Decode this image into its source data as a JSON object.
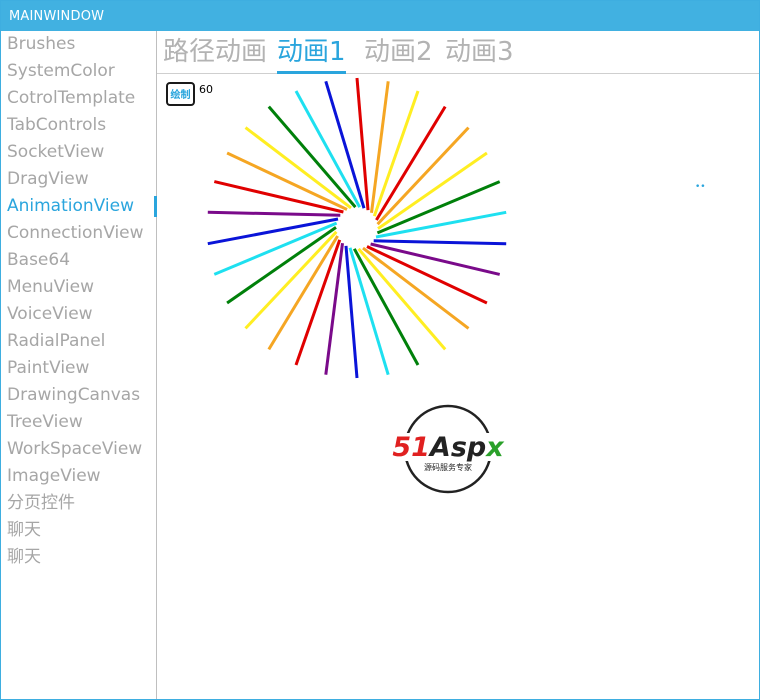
{
  "window": {
    "title": "MAINWINDOW"
  },
  "sidebar": {
    "items": [
      {
        "label": "Brushes"
      },
      {
        "label": "SystemColor"
      },
      {
        "label": "CotrolTemplate"
      },
      {
        "label": "TabControls"
      },
      {
        "label": "SocketView"
      },
      {
        "label": "DragView"
      },
      {
        "label": "AnimationView",
        "active": true
      },
      {
        "label": "ConnectionView"
      },
      {
        "label": "Base64"
      },
      {
        "label": "MenuView"
      },
      {
        "label": "VoiceView"
      },
      {
        "label": "RadialPanel"
      },
      {
        "label": "PaintView"
      },
      {
        "label": "DrawingCanvas"
      },
      {
        "label": "TreeView"
      },
      {
        "label": "WorkSpaceView"
      },
      {
        "label": "ImageView"
      },
      {
        "label": "分页控件"
      },
      {
        "label": "聊天"
      },
      {
        "label": "聊天"
      }
    ]
  },
  "tabs": [
    {
      "label": "路径动画"
    },
    {
      "label": "动画1",
      "active": true
    },
    {
      "label": "动画2"
    },
    {
      "label": "动画3"
    }
  ],
  "content": {
    "draw_button_label": "绘制",
    "count_value": "60",
    "small_mark": "••"
  },
  "animation": {
    "ray_count": 30,
    "colors": [
      "#e00000",
      "#f5a623",
      "#ffee22",
      "#e00000",
      "#f5a623",
      "#ffee22",
      "#00800a",
      "#1ee0f0",
      "#0a14d8",
      "#7a0a8a",
      "#e00000",
      "#f5a623",
      "#ffee22",
      "#00800a",
      "#1ee0f0",
      "#0a14d8",
      "#7a0a8a",
      "#e00000",
      "#f5a623",
      "#ffee22",
      "#00800a",
      "#1ee0f0",
      "#0a14d8",
      "#7a0a8a",
      "#e00000",
      "#f5a623",
      "#ffee22",
      "#00800a",
      "#1ee0f0",
      "#0a14d8",
      "#7a0a8a"
    ]
  },
  "logo": {
    "brand_red": "51",
    "brand_dark": "Asp",
    "brand_green": "x",
    "tagline": "源码服务专家",
    "colors": {
      "red": "#e02020",
      "dark": "#222222",
      "green": "#2aa02a"
    }
  }
}
